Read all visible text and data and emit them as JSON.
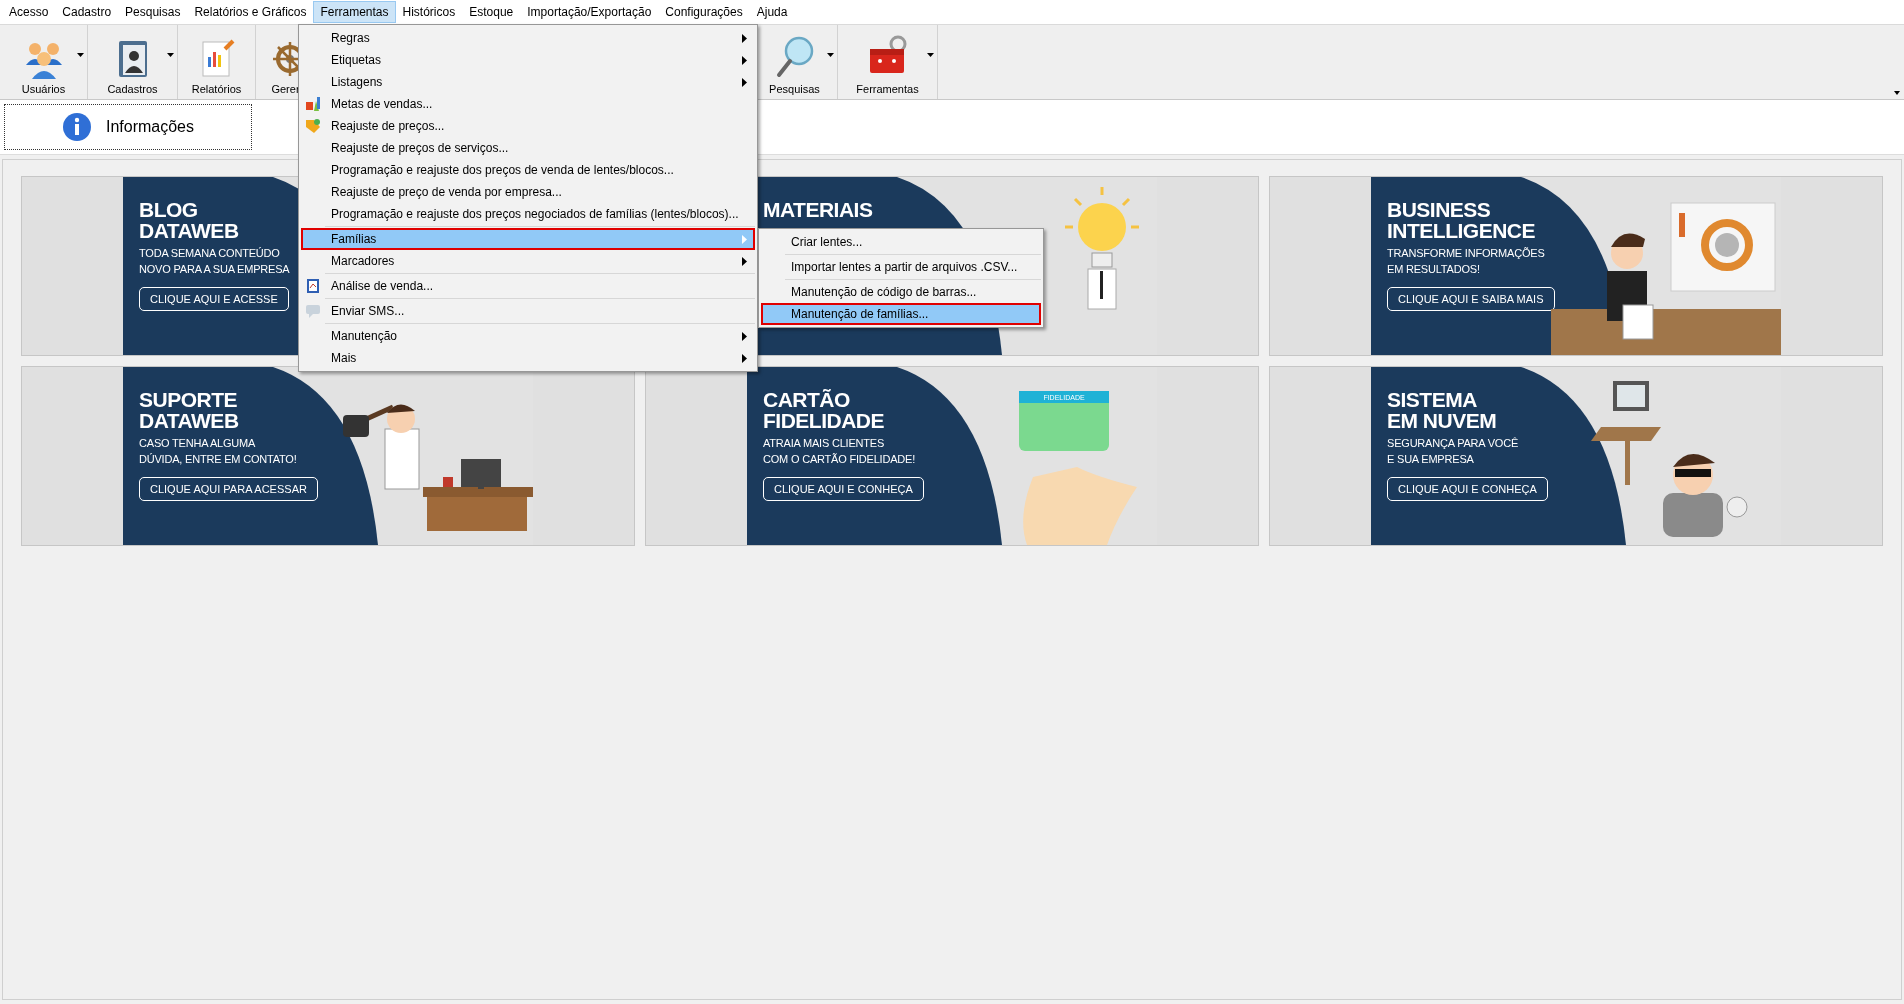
{
  "menu_bar": [
    {
      "label": "Acesso",
      "selected": false
    },
    {
      "label": "Cadastro",
      "selected": false
    },
    {
      "label": "Pesquisas",
      "selected": false
    },
    {
      "label": "Relatórios e Gráficos",
      "selected": false
    },
    {
      "label": "Ferramentas",
      "selected": true
    },
    {
      "label": "Históricos",
      "selected": false
    },
    {
      "label": "Estoque",
      "selected": false
    },
    {
      "label": "Importação/Exportação",
      "selected": false
    },
    {
      "label": "Configurações",
      "selected": false
    },
    {
      "label": "Ajuda",
      "selected": false
    }
  ],
  "toolbar_left": [
    {
      "label": "Usuários",
      "kind": "users",
      "dropdown": true
    },
    {
      "label": "Cadastros",
      "kind": "contacts",
      "dropdown": true
    },
    {
      "label": "Relatórios",
      "kind": "report",
      "dropdown": false
    },
    {
      "label": "Gerer",
      "kind": "wheel",
      "dropdown": false
    }
  ],
  "toolbar_right": [
    {
      "label": "Pesquisas",
      "kind": "search",
      "dropdown": true
    },
    {
      "label": "Ferramentas",
      "kind": "toolbox",
      "dropdown": true
    }
  ],
  "tabs": [
    {
      "label": "Informações",
      "selected": true
    }
  ],
  "menu": {
    "items": [
      {
        "label": "Regras",
        "kind": "submenu",
        "selected": false
      },
      {
        "label": "Etiquetas",
        "kind": "submenu",
        "selected": false
      },
      {
        "label": "Listagens",
        "kind": "submenu",
        "selected": false
      },
      {
        "label": "Metas de vendas...",
        "kind": "chart",
        "selected": false
      },
      {
        "label": "Reajuste de preços...",
        "kind": "tag",
        "selected": false
      },
      {
        "label": "Reajuste de preços de serviços...",
        "kind": "action",
        "selected": false
      },
      {
        "label": "Programação e reajuste dos preços de venda de lentes/blocos...",
        "kind": "action",
        "selected": false
      },
      {
        "label": "Reajuste de preço de venda por empresa...",
        "kind": "action",
        "selected": false
      },
      {
        "label": "Programação e reajuste dos preços negociados de famílias (lentes/blocos)...",
        "kind": "action",
        "selected": false
      },
      {
        "kind": "separator"
      },
      {
        "label": "Famílias",
        "kind": "submenu",
        "selected": true
      },
      {
        "label": "Marcadores",
        "kind": "submenu",
        "selected": false
      },
      {
        "kind": "separator"
      },
      {
        "label": "Análise de venda...",
        "kind": "clipboard",
        "selected": false
      },
      {
        "kind": "separator"
      },
      {
        "label": "Enviar SMS...",
        "kind": "message",
        "selected": false
      },
      {
        "kind": "separator"
      },
      {
        "label": "Manutenção",
        "kind": "submenu",
        "selected": false
      },
      {
        "label": "Mais",
        "kind": "submenu",
        "selected": false
      }
    ]
  },
  "submenu": {
    "items": [
      {
        "label": "Criar lentes...",
        "kind": "action",
        "selected": false
      },
      {
        "kind": "separator"
      },
      {
        "label": "Importar lentes a partir de arquivos .CSV...",
        "kind": "action",
        "selected": false
      },
      {
        "kind": "separator"
      },
      {
        "label": "Manutenção de código de barras...",
        "kind": "action",
        "selected": false
      },
      {
        "label": "Manutenção de famílias...",
        "kind": "action",
        "selected": true
      }
    ]
  },
  "cards": [
    {
      "kind": "blog",
      "title": [
        "BLOG",
        "DATAWEB"
      ],
      "subtitle": [
        "TODA SEMANA CONTEÚDO",
        "NOVO PARA A SUA EMPRESA"
      ],
      "button": "CLIQUE AQUI E ACESSE"
    },
    {
      "kind": "materials",
      "title": [
        "MATERIAIS"
      ]
    },
    {
      "kind": "bi",
      "title": [
        "BUSINESS",
        "INTELLIGENCE"
      ],
      "subtitle": [
        "TRANSFORME INFORMAÇÕES",
        "EM RESULTADOS!"
      ],
      "button": "CLIQUE AQUI E SAIBA MAIS"
    },
    {
      "kind": "support",
      "title": [
        "SUPORTE",
        "DATAWEB"
      ],
      "subtitle": [
        "CASO TENHA ALGUMA",
        "DÚVIDA, ENTRE EM CONTATO!"
      ],
      "button": "CLIQUE AQUI PARA ACESSAR"
    },
    {
      "kind": "loyalty",
      "title": [
        "CARTÃO",
        "FIDELIDADE"
      ],
      "subtitle": [
        "ATRAIA MAIS CLIENTES",
        "COM O CARTÃO FIDELIDADE!"
      ],
      "button": "CLIQUE AQUI E CONHEÇA",
      "art_label": "FIDELIDADE"
    },
    {
      "kind": "cloud",
      "title": [
        "SISTEMA",
        "EM NUVEM"
      ],
      "subtitle": [
        "SEGURANÇA PARA VOCÊ",
        "E SUA EMPRESA"
      ],
      "button": "CLIQUE AQUI E CONHEÇA"
    }
  ]
}
